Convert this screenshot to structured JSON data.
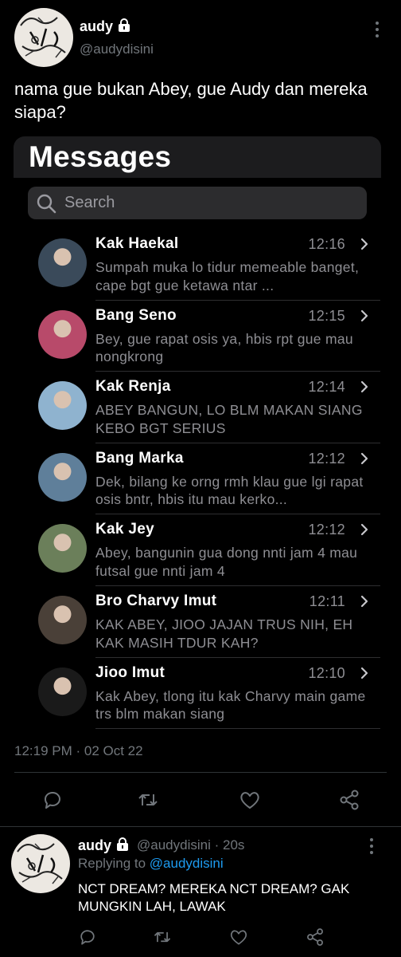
{
  "tweet": {
    "author_name": "audy",
    "author_handle": "@audydisini",
    "text": "nama gue bukan Abey, gue Audy dan mereka siapa?",
    "timestamp": "12:19 PM · 02 Oct 22"
  },
  "embedded_screenshot": {
    "title": "Messages",
    "search_placeholder": "Search",
    "conversations": [
      {
        "name": "Kak Haekal",
        "time": "12:16",
        "preview": "Sumpah muka lo tidur memeable banget, cape bgt gue ketawa ntar ...",
        "avatar_color": "#3a4a5a"
      },
      {
        "name": "Bang Seno",
        "time": "12:15",
        "preview": "Bey, gue rapat osis ya, hbis rpt gue mau nongkrong",
        "avatar_color": "#b84a6a"
      },
      {
        "name": "Kak Renja",
        "time": "12:14",
        "preview": "ABEY BANGUN, LO BLM MAKAN SIANG KEBO BGT SERIUS",
        "avatar_color": "#8fb3cf"
      },
      {
        "name": "Bang Marka",
        "time": "12:12",
        "preview": "Dek, bilang ke orng rmh klau gue lgi rapat osis bntr, hbis itu mau kerko...",
        "avatar_color": "#5f7f9a"
      },
      {
        "name": "Kak Jey",
        "time": "12:12",
        "preview": "Abey, bangunin gua dong nnti jam 4 mau futsal gue nnti jam 4",
        "avatar_color": "#6b7f5a"
      },
      {
        "name": "Bro Charvy Imut",
        "time": "12:11",
        "preview": "KAK ABEY, JIOO JAJAN TRUS NIH, EH KAK MASIH TDUR KAH?",
        "avatar_color": "#4a4038"
      },
      {
        "name": "Jioo Imut",
        "time": "12:10",
        "preview": "Kak Abey, tlong itu kak Charvy main game trs blm makan siang",
        "avatar_color": "#1a1a1a"
      }
    ]
  },
  "reply": {
    "author_name": "audy",
    "author_handle": "@audydisini",
    "age": "· 20s",
    "replying_to_label": "Replying to",
    "replying_to_handle": "@audydisini",
    "text": "NCT DREAM? MEREKA NCT DREAM? GAK MUNGKIN LAH, LAWAK"
  },
  "icons": [
    "lock-icon",
    "more-icon",
    "search-icon",
    "chevron-right-icon",
    "reply-icon",
    "retweet-icon",
    "like-icon",
    "share-icon"
  ],
  "colors": {
    "background": "#000000",
    "accent": "#1d9bf0",
    "muted": "#71767b"
  }
}
